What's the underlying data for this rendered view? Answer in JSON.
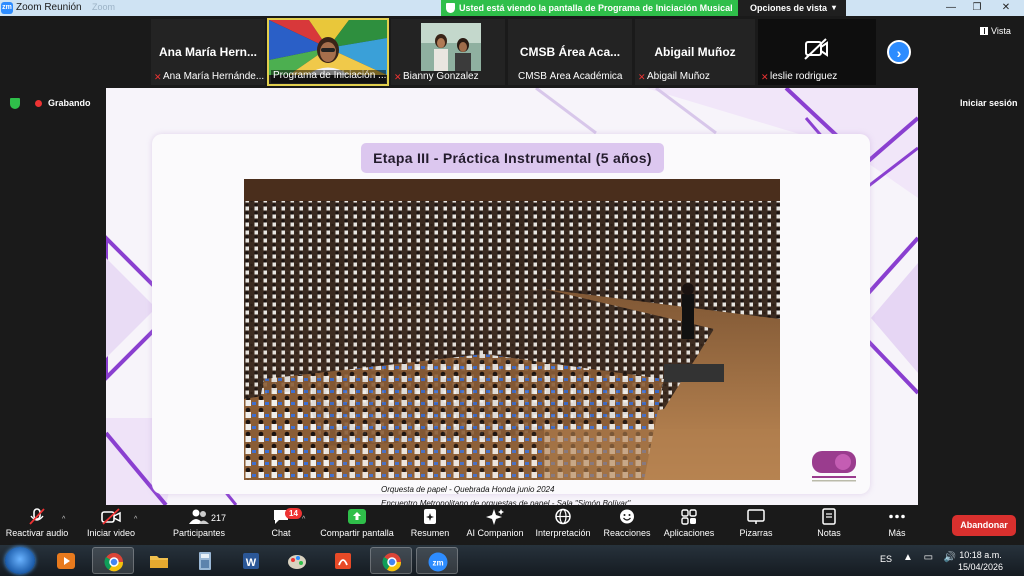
{
  "window": {
    "app_title": "Zoom Reunión",
    "ghost_title": "Zoom",
    "app_icon_text": "zm",
    "share_banner": "Usted está viendo la pantalla de Programa de Iniciación Musical",
    "view_options": "Opciones de vista",
    "view_button": "Vista",
    "minimize_glyph": "—",
    "maximize_glyph": "❐",
    "close_glyph": "✕"
  },
  "participants": [
    {
      "name": "Ana María Hern...",
      "label": "Ana María Hernánde...",
      "muted": true
    },
    {
      "name": "",
      "label": "Programa de Iniciación ...",
      "muted": false,
      "has_video": true,
      "active_speaker": true
    },
    {
      "name": "",
      "label": "Bianny Gonzalez",
      "muted": true,
      "has_video": true
    },
    {
      "name": "CMSB Área Aca...",
      "label": "CMSB Área Académica",
      "muted": false
    },
    {
      "name": "Abigail Muñoz",
      "label": "Abigail Muñoz",
      "muted": true
    },
    {
      "name": "",
      "label": "leslie rodriguez",
      "muted": true,
      "camera_off": true
    }
  ],
  "next_arrow": "›",
  "recording_label": "Grabando",
  "signin_label": "Iniciar sesión",
  "slide": {
    "title": "Etapa III - Práctica Instrumental (5 años)",
    "caption_line1": "Orquesta de papel - Quebrada Honda junio 2024",
    "caption_line2": "Encuentro Metropolitano de orquestas de papel - Sala \"Simón Bolívar\"",
    "logo_text": "EL SISTEMA",
    "logo_subtext": "PROGRAMA DE INICIACIÓN MUSICAL"
  },
  "toolbar": {
    "mute_audio": "Reactivar audio",
    "start_video": "Iniciar video",
    "participants": "Participantes",
    "participants_count": "217",
    "chat": "Chat",
    "chat_badge": "14",
    "share_screen": "Compartir pantalla",
    "summary": "Resumen",
    "ai_companion": "AI Companion",
    "interpretation": "Interpretación",
    "reactions": "Reacciones",
    "apps": "Aplicaciones",
    "whiteboards": "Pizarras",
    "notes": "Notas",
    "more": "Más",
    "leave": "Abandonar",
    "caret": "^"
  },
  "taskbar": {
    "language": "ES",
    "tray_icons": "▲ ▭ 🔊",
    "time": "10:18 a.m.",
    "date": "15/04/2026",
    "apps": [
      "media-player",
      "chrome",
      "file-explorer",
      "calculator",
      "word",
      "paint",
      "acrobat",
      "chrome",
      "zoom"
    ]
  },
  "colors": {
    "zoom_blue": "#2d8cff",
    "share_green": "#2fbf4a",
    "leave_red": "#d9302e",
    "slide_purple": "#dcc7ef",
    "deco_purple": "#8a3fd0"
  }
}
